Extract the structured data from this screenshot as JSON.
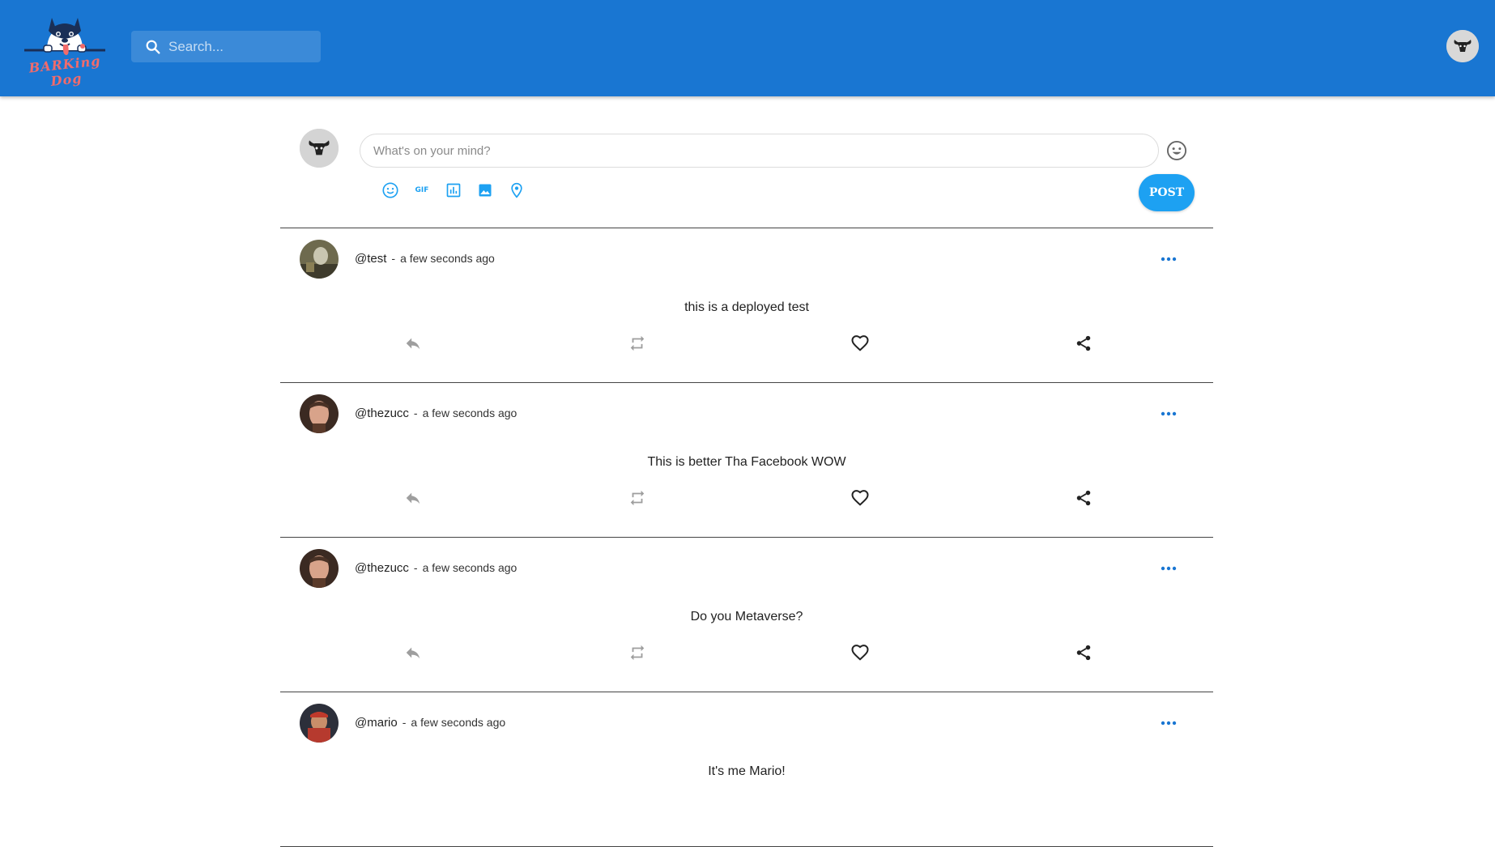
{
  "header": {
    "logo_text": "BARKing Dog",
    "search_placeholder": "Search...",
    "brand_color": "#1976d2"
  },
  "composer": {
    "placeholder": "What's on your mind?",
    "post_label": "POST",
    "tool_gif_label": "GIF",
    "accent_color": "#1da1f2",
    "tools": [
      "emoji-icon",
      "gif-icon",
      "poll-icon",
      "image-icon",
      "location-icon"
    ]
  },
  "posts": [
    {
      "handle": "@test",
      "separator": "-",
      "time": "a few seconds ago",
      "text": "this is a deployed test",
      "avatar": "user-avatar"
    },
    {
      "handle": "@thezucc",
      "separator": "-",
      "time": "a few seconds ago",
      "text": "This is better Tha Facebook WOW",
      "avatar": "user-avatar"
    },
    {
      "handle": "@thezucc",
      "separator": "-",
      "time": "a few seconds ago",
      "text": "Do you Metaverse?",
      "avatar": "user-avatar"
    },
    {
      "handle": "@mario",
      "separator": "-",
      "time": "a few seconds ago",
      "text": "It's me Mario!",
      "avatar": "user-avatar"
    }
  ],
  "post_actions": [
    "reply-icon",
    "retweet-icon",
    "like-icon",
    "share-icon"
  ]
}
